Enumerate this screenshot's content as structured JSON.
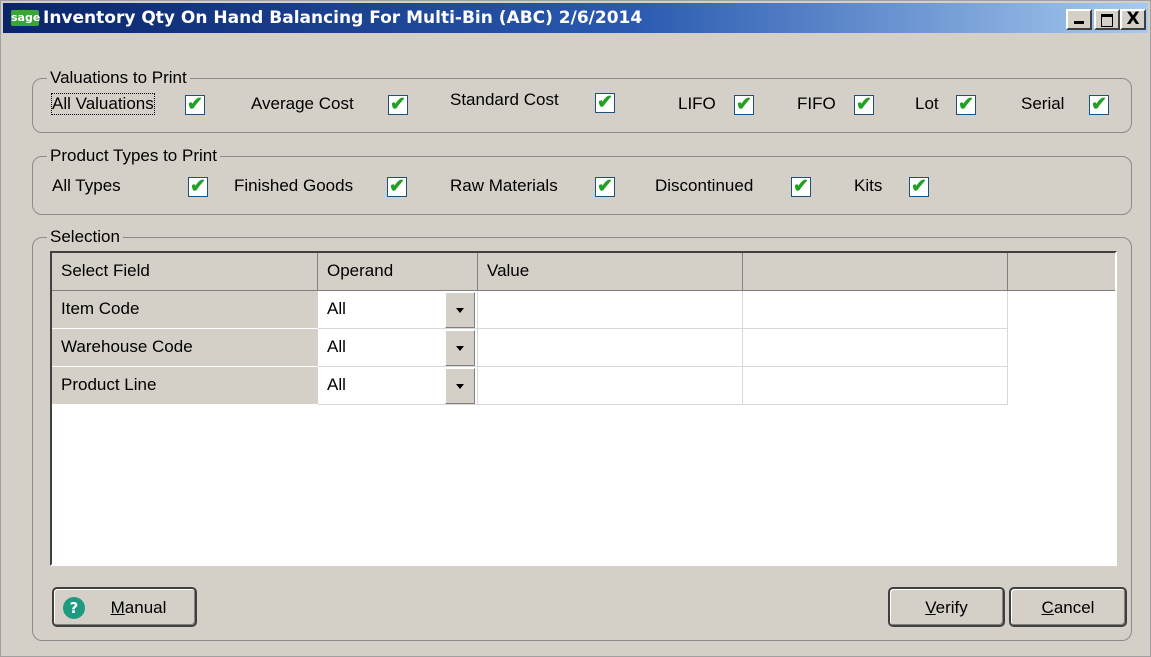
{
  "window": {
    "title": "Inventory Qty On Hand Balancing For Multi-Bin (ABC) 2/6/2014",
    "logo": "sage",
    "controls": {
      "minimize": "_",
      "maximize": "□",
      "close": "X"
    }
  },
  "valuations": {
    "legend": "Valuations to Print",
    "options": [
      {
        "label": "All Valuations",
        "checked": true
      },
      {
        "label": "Average Cost",
        "checked": true
      },
      {
        "label": "Standard Cost",
        "checked": true
      },
      {
        "label": "LIFO",
        "checked": true
      },
      {
        "label": "FIFO",
        "checked": true
      },
      {
        "label": "Lot",
        "checked": true
      },
      {
        "label": "Serial",
        "checked": true
      }
    ]
  },
  "product_types": {
    "legend": "Product Types to Print",
    "options": [
      {
        "label": "All Types",
        "checked": true
      },
      {
        "label": "Finished Goods",
        "checked": true
      },
      {
        "label": "Raw Materials",
        "checked": true
      },
      {
        "label": "Discontinued",
        "checked": true
      },
      {
        "label": "Kits",
        "checked": true
      }
    ]
  },
  "selection": {
    "legend": "Selection",
    "columns": [
      "Select Field",
      "Operand",
      "Value",
      ""
    ],
    "rows": [
      {
        "field": "Item Code",
        "operand": "All",
        "value": "",
        "extra": ""
      },
      {
        "field": "Warehouse Code",
        "operand": "All",
        "value": "",
        "extra": ""
      },
      {
        "field": "Product Line",
        "operand": "All",
        "value": "",
        "extra": ""
      }
    ]
  },
  "buttons": {
    "manual": {
      "prefix": "",
      "hotkey": "M",
      "rest": "anual",
      "icon": "help-icon"
    },
    "verify": {
      "prefix": "",
      "hotkey": "V",
      "rest": "erify"
    },
    "cancel": {
      "prefix": "",
      "hotkey": "C",
      "rest": "ancel"
    }
  },
  "colors": {
    "window_bg": "#d4d0c8",
    "title_start": "#0a246a",
    "title_end": "#a6caf0",
    "check": "#21a121",
    "help_icon": "#1e9a80"
  },
  "check_glyph": "✔",
  "help_glyph": "?"
}
